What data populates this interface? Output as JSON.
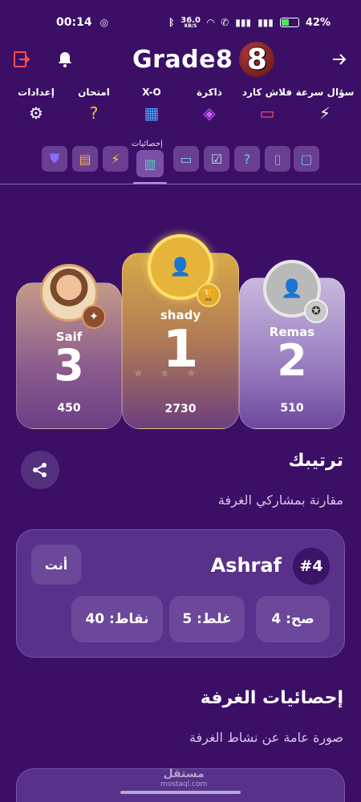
{
  "status_bar": {
    "time": "00:14",
    "speed": "36.0",
    "speed_unit": "KB/S",
    "battery": "42%"
  },
  "header": {
    "title": "Grade8",
    "badge": "8"
  },
  "modes": [
    {
      "label": "إعدادات",
      "icon": "gear-icon",
      "glyph": "⚙",
      "color": "#ffffff"
    },
    {
      "label": "امتحان",
      "icon": "exam-question-icon",
      "glyph": "?",
      "color": "#f5c242"
    },
    {
      "label": "X-O",
      "icon": "grid-icon",
      "glyph": "▦",
      "color": "#4aa8ff"
    },
    {
      "label": "ذاكرة",
      "icon": "chip-icon",
      "glyph": "◈",
      "color": "#c45cff"
    },
    {
      "label": "فلاش كارد",
      "icon": "cards-icon",
      "glyph": "▭",
      "color": "#ff4f8b"
    },
    {
      "label": "سؤال سرعة",
      "icon": "lightning-icon",
      "glyph": "⚡",
      "color": "#ffffff"
    }
  ],
  "tabs": {
    "active_label": "إحصائيات"
  },
  "podium": {
    "left": {
      "name": "Saif",
      "rank": "3",
      "score": "450"
    },
    "mid": {
      "name": "shady",
      "rank": "1",
      "score": "2730"
    },
    "right": {
      "name": "Remas",
      "rank": "2",
      "score": "510"
    }
  },
  "ranking": {
    "title": "ترتيبك",
    "subtitle": "مقارنة بمشاركي الغرفة"
  },
  "my_card": {
    "you_label": "أنت",
    "name": "Ashraf",
    "rank": "#4",
    "correct": "صح: 4",
    "wrong": "غلط: 5",
    "points": "نقاط: 40"
  },
  "room_stats": {
    "title": "إحصائيات الغرفة",
    "subtitle": "صورة عامة عن نشاط الغرفة"
  },
  "watermark": {
    "ar": "مستقل",
    "en": "mostaql.com"
  }
}
